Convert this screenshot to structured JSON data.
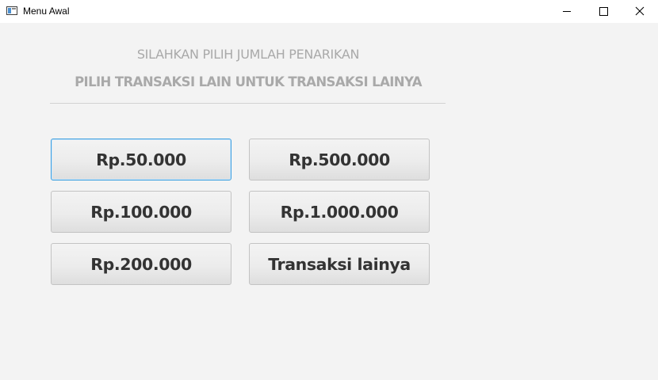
{
  "window": {
    "title": "Menu Awal",
    "controls": [
      "minimize-icon",
      "maximize-icon",
      "close-icon"
    ]
  },
  "header": {
    "line1": "SILAHKAN PILIH JUMLAH PENARIKAN",
    "line2": "PILIH TRANSAKSI LAIN UNTUK TRANSAKSI LAINYA"
  },
  "buttons": [
    {
      "label": "Rp.50.000",
      "focused": true
    },
    {
      "label": "Rp.500.000",
      "focused": false
    },
    {
      "label": "Rp.100.000",
      "focused": false
    },
    {
      "label": "Rp.1.000.000",
      "focused": false
    },
    {
      "label": "Rp.200.000",
      "focused": false
    },
    {
      "label": "Transaksi lainya",
      "focused": false
    }
  ],
  "colors": {
    "background": "#f3f3f3",
    "heading": "#a9a9a9",
    "button_text": "#333333",
    "focus_border": "#3c9fe0"
  }
}
